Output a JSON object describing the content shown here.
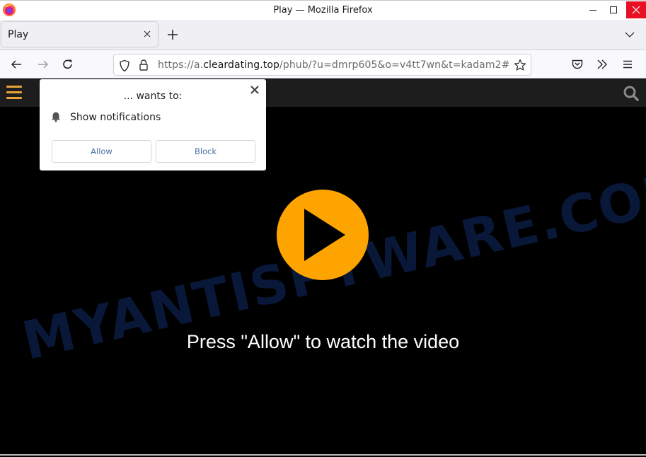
{
  "window": {
    "title": "Play — Mozilla Firefox",
    "controls": {
      "minimize": "minimize",
      "maximize": "maximize",
      "close": "close"
    },
    "close_color": "#e81123"
  },
  "tabs": [
    {
      "label": "Play",
      "active": true
    }
  ],
  "toolbar": {
    "url_prefix": "https://a.",
    "url_domain": "cleardating.top",
    "url_suffix": "/phub/?u=dmrp605&o=v4tt7wn&t=kadam2#"
  },
  "page": {
    "accent_color": "#fea400",
    "header_menu_color": "#e8a23a",
    "cta_text": "Press \"Allow\" to watch the video",
    "watermark": "MYANTISPYWARE.COM"
  },
  "permission_popup": {
    "title": "... wants to:",
    "item": "Show notifications",
    "allow_label": "Allow",
    "block_label": "Block"
  }
}
